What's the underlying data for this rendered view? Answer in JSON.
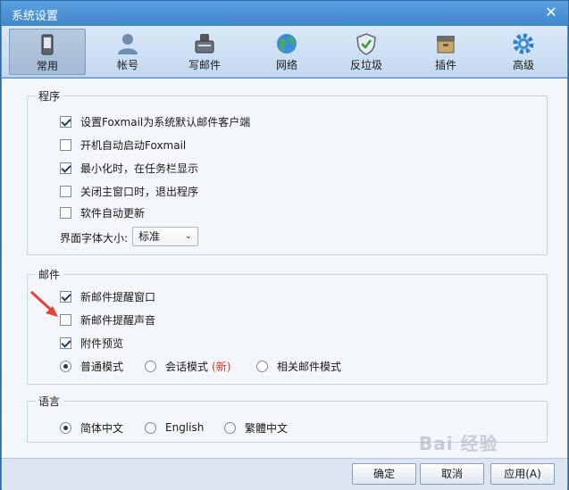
{
  "window": {
    "title": "系统设置",
    "close_glyph": "✕"
  },
  "toolbar": {
    "tabs": [
      {
        "label": "常用",
        "icon": "phone-icon",
        "active": true
      },
      {
        "label": "帐号",
        "icon": "user-icon",
        "active": false
      },
      {
        "label": "写邮件",
        "icon": "compose-icon",
        "active": false
      },
      {
        "label": "网络",
        "icon": "globe-icon",
        "active": false
      },
      {
        "label": "反垃圾",
        "icon": "shield-icon",
        "active": false
      },
      {
        "label": "插件",
        "icon": "plugin-icon",
        "active": false
      },
      {
        "label": "高级",
        "icon": "gear-icon",
        "active": false
      }
    ]
  },
  "program": {
    "title": "程序",
    "options": [
      {
        "label": "设置Foxmail为系统默认邮件客户端",
        "checked": true
      },
      {
        "label": "开机自动启动Foxmail",
        "checked": false
      },
      {
        "label": "最小化时，在任务栏显示",
        "checked": true
      },
      {
        "label": "关闭主窗口时，退出程序",
        "checked": false
      },
      {
        "label": "软件自动更新",
        "checked": false
      }
    ],
    "font_size_label": "界面字体大小:",
    "font_size_value": "标准"
  },
  "mail": {
    "title": "邮件",
    "options": [
      {
        "label": "新邮件提醒窗口",
        "checked": true
      },
      {
        "label": "新邮件提醒声音",
        "checked": false
      },
      {
        "label": "附件预览",
        "checked": true
      }
    ],
    "modes": [
      {
        "label": "普通模式",
        "checked": true
      },
      {
        "label": "会话模式",
        "checked": false,
        "tag": "(新)"
      },
      {
        "label": "相关邮件模式",
        "checked": false
      }
    ]
  },
  "language": {
    "title": "语言",
    "options": [
      {
        "label": "简体中文",
        "checked": true
      },
      {
        "label": "English",
        "checked": false
      },
      {
        "label": "繁體中文",
        "checked": false
      }
    ]
  },
  "footer": {
    "ok": "确定",
    "cancel": "取消",
    "apply": "应用(A)"
  },
  "watermark": "Bai 经验",
  "colors": {
    "accent": "#4a8fd0",
    "new_tag": "#d03a2a",
    "annotation_arrow": "#e8413a"
  }
}
